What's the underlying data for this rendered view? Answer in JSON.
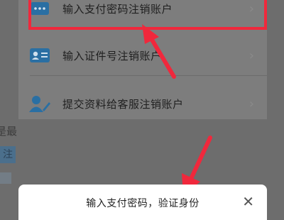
{
  "options": [
    {
      "label": "输入支付密码注销账户",
      "icon": "password-keyboard-icon"
    },
    {
      "label": "输入证件号注销账户",
      "icon": "id-card-icon"
    },
    {
      "label": "提交资料给客服注销账户",
      "icon": "customer-service-icon"
    }
  ],
  "chevron": "›",
  "background": {
    "partial_text": "是最",
    "partial_chip": "注"
  },
  "dialog": {
    "title": "输入支付密码，验证身份",
    "close": "✕"
  },
  "colors": {
    "highlight": "#f0283c",
    "icon": "#2a6fa3",
    "overlay": "#6d6d6d"
  }
}
